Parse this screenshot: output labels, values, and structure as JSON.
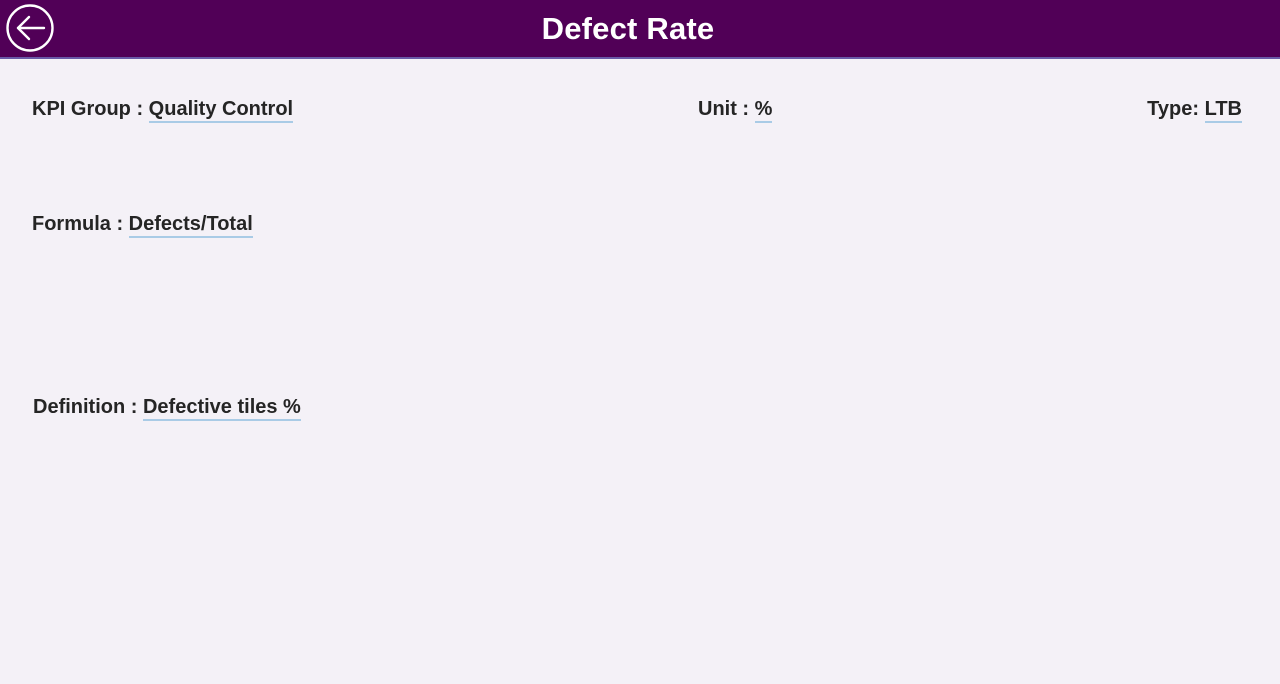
{
  "header": {
    "title": "Defect Rate",
    "back_icon": "arrow-left-circle-icon",
    "background_color": "#510057"
  },
  "kpi": {
    "group_label": "KPI Group : ",
    "group_value": "Quality Control",
    "unit_label": "Unit : ",
    "unit_value": "%",
    "type_label": "Type: ",
    "type_value": "LTB",
    "formula_label": "Formula : ",
    "formula_value": "Defects/Total",
    "definition_label": "Definition : ",
    "definition_value": "Defective tiles %"
  }
}
